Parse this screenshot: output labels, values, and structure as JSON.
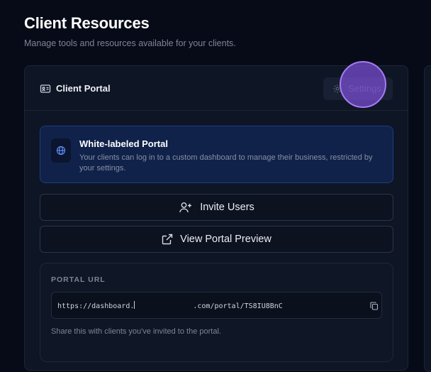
{
  "page": {
    "title": "Client Resources",
    "subtitle": "Manage tools and resources available for your clients."
  },
  "card": {
    "title": "Client Portal",
    "title_icon": "id-card-icon",
    "settings_label": "Settings",
    "settings_icon": "gear-icon"
  },
  "banner": {
    "icon": "globe-icon",
    "title": "White-labeled Portal",
    "description": "Your clients can log in to a custom dashboard to manage their business, restricted by your settings."
  },
  "actions": {
    "invite_label": "Invite Users",
    "invite_icon": "user-plus-icon",
    "preview_label": "View Portal Preview",
    "preview_icon": "external-link-icon"
  },
  "portal_url": {
    "label": "PORTAL URL",
    "url_prefix": "https://dashboard.",
    "url_suffix": ".com/portal/TS8IU8BnC",
    "copy_icon": "copy-icon",
    "hint": "Share this with clients you've invited to the portal."
  },
  "colors": {
    "background": "#070b17",
    "card": "#0e1524",
    "banner": "#10224a",
    "banner_border": "#1d3c7a",
    "accent_cursor": "#7c4dd6"
  }
}
